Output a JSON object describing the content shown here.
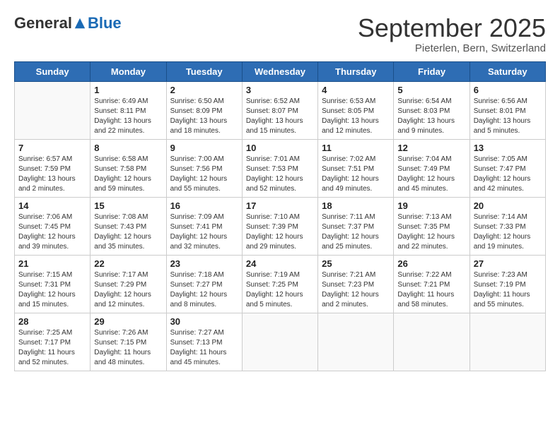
{
  "header": {
    "logo": {
      "general": "General",
      "blue": "Blue"
    },
    "title": "September 2025",
    "location": "Pieterlen, Bern, Switzerland"
  },
  "days_of_week": [
    "Sunday",
    "Monday",
    "Tuesday",
    "Wednesday",
    "Thursday",
    "Friday",
    "Saturday"
  ],
  "weeks": [
    [
      {
        "day": "",
        "content": ""
      },
      {
        "day": "1",
        "content": "Sunrise: 6:49 AM\nSunset: 8:11 PM\nDaylight: 13 hours\nand 22 minutes."
      },
      {
        "day": "2",
        "content": "Sunrise: 6:50 AM\nSunset: 8:09 PM\nDaylight: 13 hours\nand 18 minutes."
      },
      {
        "day": "3",
        "content": "Sunrise: 6:52 AM\nSunset: 8:07 PM\nDaylight: 13 hours\nand 15 minutes."
      },
      {
        "day": "4",
        "content": "Sunrise: 6:53 AM\nSunset: 8:05 PM\nDaylight: 13 hours\nand 12 minutes."
      },
      {
        "day": "5",
        "content": "Sunrise: 6:54 AM\nSunset: 8:03 PM\nDaylight: 13 hours\nand 9 minutes."
      },
      {
        "day": "6",
        "content": "Sunrise: 6:56 AM\nSunset: 8:01 PM\nDaylight: 13 hours\nand 5 minutes."
      }
    ],
    [
      {
        "day": "7",
        "content": "Sunrise: 6:57 AM\nSunset: 7:59 PM\nDaylight: 13 hours\nand 2 minutes."
      },
      {
        "day": "8",
        "content": "Sunrise: 6:58 AM\nSunset: 7:58 PM\nDaylight: 12 hours\nand 59 minutes."
      },
      {
        "day": "9",
        "content": "Sunrise: 7:00 AM\nSunset: 7:56 PM\nDaylight: 12 hours\nand 55 minutes."
      },
      {
        "day": "10",
        "content": "Sunrise: 7:01 AM\nSunset: 7:53 PM\nDaylight: 12 hours\nand 52 minutes."
      },
      {
        "day": "11",
        "content": "Sunrise: 7:02 AM\nSunset: 7:51 PM\nDaylight: 12 hours\nand 49 minutes."
      },
      {
        "day": "12",
        "content": "Sunrise: 7:04 AM\nSunset: 7:49 PM\nDaylight: 12 hours\nand 45 minutes."
      },
      {
        "day": "13",
        "content": "Sunrise: 7:05 AM\nSunset: 7:47 PM\nDaylight: 12 hours\nand 42 minutes."
      }
    ],
    [
      {
        "day": "14",
        "content": "Sunrise: 7:06 AM\nSunset: 7:45 PM\nDaylight: 12 hours\nand 39 minutes."
      },
      {
        "day": "15",
        "content": "Sunrise: 7:08 AM\nSunset: 7:43 PM\nDaylight: 12 hours\nand 35 minutes."
      },
      {
        "day": "16",
        "content": "Sunrise: 7:09 AM\nSunset: 7:41 PM\nDaylight: 12 hours\nand 32 minutes."
      },
      {
        "day": "17",
        "content": "Sunrise: 7:10 AM\nSunset: 7:39 PM\nDaylight: 12 hours\nand 29 minutes."
      },
      {
        "day": "18",
        "content": "Sunrise: 7:11 AM\nSunset: 7:37 PM\nDaylight: 12 hours\nand 25 minutes."
      },
      {
        "day": "19",
        "content": "Sunrise: 7:13 AM\nSunset: 7:35 PM\nDaylight: 12 hours\nand 22 minutes."
      },
      {
        "day": "20",
        "content": "Sunrise: 7:14 AM\nSunset: 7:33 PM\nDaylight: 12 hours\nand 19 minutes."
      }
    ],
    [
      {
        "day": "21",
        "content": "Sunrise: 7:15 AM\nSunset: 7:31 PM\nDaylight: 12 hours\nand 15 minutes."
      },
      {
        "day": "22",
        "content": "Sunrise: 7:17 AM\nSunset: 7:29 PM\nDaylight: 12 hours\nand 12 minutes."
      },
      {
        "day": "23",
        "content": "Sunrise: 7:18 AM\nSunset: 7:27 PM\nDaylight: 12 hours\nand 8 minutes."
      },
      {
        "day": "24",
        "content": "Sunrise: 7:19 AM\nSunset: 7:25 PM\nDaylight: 12 hours\nand 5 minutes."
      },
      {
        "day": "25",
        "content": "Sunrise: 7:21 AM\nSunset: 7:23 PM\nDaylight: 12 hours\nand 2 minutes."
      },
      {
        "day": "26",
        "content": "Sunrise: 7:22 AM\nSunset: 7:21 PM\nDaylight: 11 hours\nand 58 minutes."
      },
      {
        "day": "27",
        "content": "Sunrise: 7:23 AM\nSunset: 7:19 PM\nDaylight: 11 hours\nand 55 minutes."
      }
    ],
    [
      {
        "day": "28",
        "content": "Sunrise: 7:25 AM\nSunset: 7:17 PM\nDaylight: 11 hours\nand 52 minutes."
      },
      {
        "day": "29",
        "content": "Sunrise: 7:26 AM\nSunset: 7:15 PM\nDaylight: 11 hours\nand 48 minutes."
      },
      {
        "day": "30",
        "content": "Sunrise: 7:27 AM\nSunset: 7:13 PM\nDaylight: 11 hours\nand 45 minutes."
      },
      {
        "day": "",
        "content": ""
      },
      {
        "day": "",
        "content": ""
      },
      {
        "day": "",
        "content": ""
      },
      {
        "day": "",
        "content": ""
      }
    ]
  ]
}
